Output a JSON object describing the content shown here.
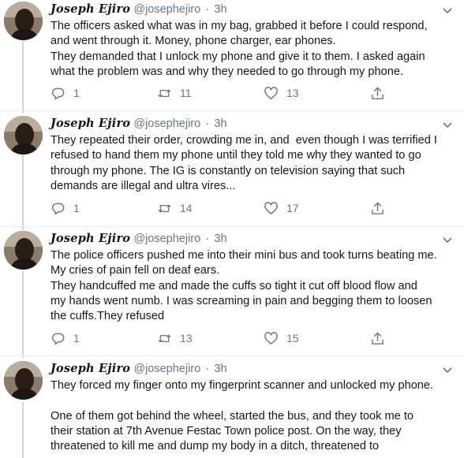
{
  "tweets": [
    {
      "display_name": "Joseph Ejiro",
      "handle": "@josephejiro",
      "separator": "·",
      "time": "3h",
      "text": "The officers asked what was in my bag, grabbed it before I could respond,\nand went through it. Money, phone charger, ear phones.\nThey demanded that I unlock my phone and give it to them. I asked again\nwhat the problem was and why they needed to go through my phone.",
      "replies": "1",
      "retweets": "11",
      "likes": "13"
    },
    {
      "display_name": "Joseph Ejiro",
      "handle": "@josephejiro",
      "separator": "·",
      "time": "3h",
      "text": "They repeated their order, crowding me in, and  even though I was terrified I\nrefused to hand them my phone until they told me why they wanted to go\nthrough my phone. The IG is constantly on television saying that such\ndemands are illegal and ultra vires...",
      "replies": "1",
      "retweets": "14",
      "likes": "17"
    },
    {
      "display_name": "Joseph Ejiro",
      "handle": "@josephejiro",
      "separator": "·",
      "time": "3h",
      "text": "The police officers pushed me into their mini bus and took turns beating me.\nMy cries of pain fell on deaf ears.\nThey handcuffed me and made the cuffs so tight it cut off blood flow and\nmy hands went numb. I was screaming in pain and begging them to loosen\nthe cuffs.They refused",
      "replies": "1",
      "retweets": "13",
      "likes": "15"
    },
    {
      "display_name": "Joseph Ejiro",
      "handle": "@josephejiro",
      "separator": "·",
      "time": "3h",
      "text": "They forced my finger onto my fingerprint scanner and unlocked my phone.\n\nOne of them got behind the wheel, started the bus, and they took me to\ntheir station at 7th Avenue Festac Town police post. On the way, they\nthreatened to kill me and dump my body in a ditch, threatened to"
    }
  ],
  "icons": {
    "reply": "reply-icon",
    "retweet": "retweet-icon",
    "like": "heart-icon",
    "share": "share-icon",
    "caret": "chevron-down-icon"
  },
  "colors": {
    "text": "#14171a",
    "muted": "#657786",
    "thread_line": "#ccd6dd",
    "divider": "#e6ecf0"
  }
}
